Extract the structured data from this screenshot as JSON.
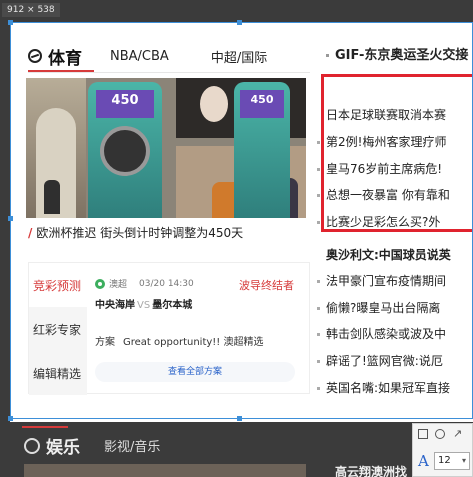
{
  "screenshot_label": "912 × 538",
  "sports": {
    "title": "体育",
    "tabs": [
      "NBA/CBA",
      "中超/国际"
    ],
    "photo_screen_text": "450",
    "caption": "欧洲杯推迟 街头倒计时钟调整为450天",
    "caption_slash": "/"
  },
  "lottery": {
    "tabs": [
      "竞彩预测",
      "红彩专家",
      "编辑精选"
    ],
    "league": "澳超",
    "time": "03/20 14:30",
    "expert": "波导终结者",
    "home": "中央海岸",
    "vs": "VS",
    "away": "墨尔本城",
    "plan_label": "方案",
    "plan_text": "Great opportunity!! 澳超精选",
    "view_all": "查看全部方案"
  },
  "right_news": {
    "headline": "GIF-东京奥运圣火交接",
    "items": [
      {
        "text": "日本足球联赛取消本赛",
        "bold": false
      },
      {
        "text": "第2例!梅州客家理疗师",
        "bold": false
      },
      {
        "text": "皇马76岁前主席病危!",
        "bold": false
      },
      {
        "text": "总想一夜暴富 你有靠和",
        "bold": false
      },
      {
        "text": "比赛少足彩怎么买?外",
        "bold": false
      },
      {
        "text": "奥沙利文:中国球员说英",
        "bold": true
      },
      {
        "text": "法甲豪门宣布疫情期间",
        "bold": false
      },
      {
        "text": "偷懒?曝皇马出台隔离",
        "bold": false
      },
      {
        "text": "韩击剑队感染或波及中",
        "bold": false
      },
      {
        "text": "辟谣了!篮网官微:说厄",
        "bold": false
      },
      {
        "text": "英国名嘴:如果冠军直接",
        "bold": false
      }
    ]
  },
  "entertainment": {
    "title": "娱乐",
    "tab": "影视/音乐",
    "news": "高云翔澳洲找"
  },
  "annotation_toolbar": {
    "font_size": "12",
    "text_tool": "A",
    "arrow_glyph": "↗",
    "caret_glyph": "▾"
  },
  "colors": {
    "accent_red": "#d63a3a",
    "highlight_box": "#e0232e",
    "selection_blue": "#3d8fd8"
  }
}
